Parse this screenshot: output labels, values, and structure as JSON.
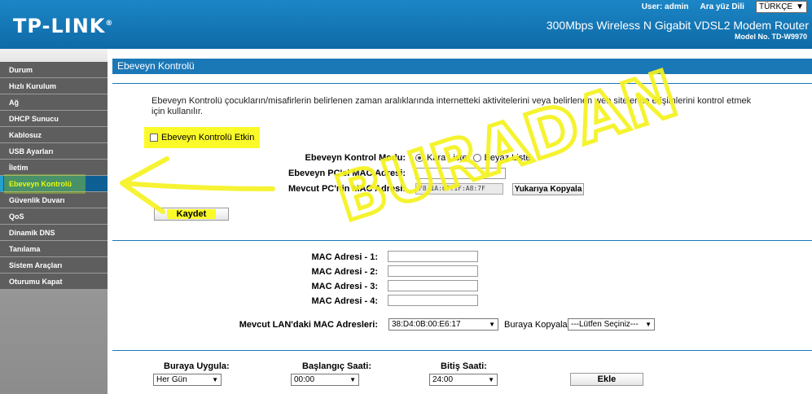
{
  "header": {
    "logo": "TP-LINK",
    "logo_mark": "®",
    "user_label": "User: admin",
    "lang_label": "Ara yüz Dili",
    "lang_value": "TÜRKÇE",
    "product": "300Mbps Wireless N Gigabit VDSL2 Modem Router",
    "model": "Model No. TD-W9970"
  },
  "sidebar": {
    "items": [
      {
        "label": "Durum"
      },
      {
        "label": "Hızlı Kurulum"
      },
      {
        "label": "Ağ"
      },
      {
        "label": "DHCP Sunucu"
      },
      {
        "label": "Kablosuz"
      },
      {
        "label": "USB Ayarları"
      },
      {
        "label": "İletim"
      },
      {
        "label": "Ebeveyn Kontrolü"
      },
      {
        "label": "Güvenlik Duvarı"
      },
      {
        "label": "QoS"
      },
      {
        "label": "Dinamik DNS"
      },
      {
        "label": "Tanılama"
      },
      {
        "label": "Sistem Araçları"
      },
      {
        "label": "Oturumu Kapat"
      }
    ]
  },
  "main": {
    "title": "Ebeveyn Kontrolü",
    "description": "Ebeveyn Kontrolü çocukların/misafirlerin belirlenen zaman aralıklarında internetteki aktivitelerini veya belirlenen web sitelerine erişimlerini kontrol etmek için kullanılır.",
    "enable_label": "Ebeveyn Kontrolü Etkin",
    "mode_label": "Ebeveyn Kontrol Modu:",
    "mode_blacklist": "Kara Liste",
    "mode_whitelist": "Beyaz Liste",
    "parent_mac_label": "Ebeveyn PC'si MAC Adresi:",
    "current_mac_label": "Mevcut PC'nin MAC Adresi:",
    "current_mac_value": "F8:1A:67:1F:A8:7F",
    "copy_up_button": "Yukarıya Kopyala",
    "save_button": "Kaydet",
    "mac_labels": [
      "MAC Adresi - 1:",
      "MAC Adresi - 2:",
      "MAC Adresi - 3:",
      "MAC Adresi - 4:"
    ],
    "lan_mac_label": "Mevcut LAN'daki MAC Adresleri:",
    "lan_mac_value": "38:D4:0B:00:E6:17",
    "copy_here_label": "Buraya Kopyala",
    "copy_here_select": "---Lütfen Seçiniz---",
    "apply_label": "Buraya Uygula:",
    "apply_value": "Her Gün",
    "start_label": "Başlangıç Saati:",
    "start_value": "00:00",
    "end_label": "Bitiş Saati:",
    "end_value": "24:00",
    "add_button": "Ekle"
  },
  "annotation": {
    "text": "BURADAN",
    "color": "#f5f21e"
  }
}
